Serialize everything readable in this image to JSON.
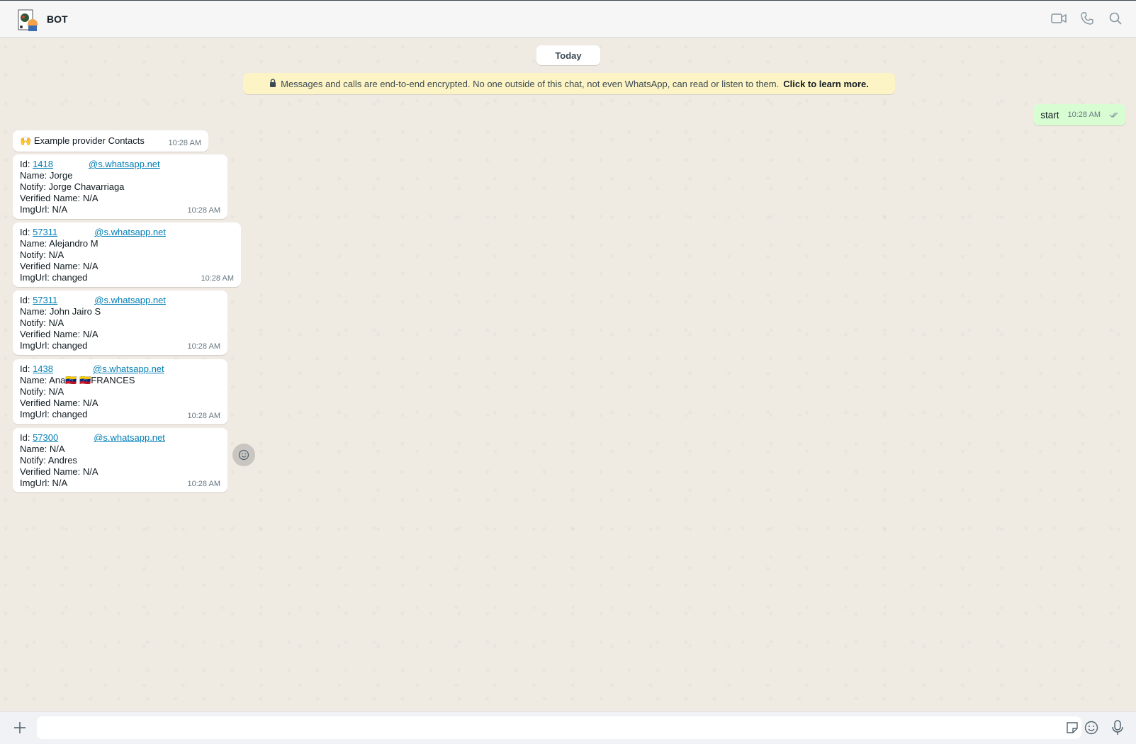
{
  "header": {
    "title": "BOT",
    "icons": [
      "video-call-icon",
      "voice-call-icon",
      "search-icon"
    ]
  },
  "chat": {
    "date_chip": "Today",
    "encryption": {
      "text": "Messages and calls are end-to-end encrypted. No one outside of this chat, not even WhatsApp, can read or listen to them.",
      "link": "Click to learn more."
    },
    "outgoing": {
      "text": "start",
      "time": "10:28 AM"
    },
    "heading": {
      "emoji": "🙌",
      "text": "Example provider Contacts",
      "time": "10:28 AM"
    },
    "contacts": [
      {
        "id_prefix": "Id: ",
        "id_num": "1418",
        "id_domain": "@s.whatsapp.net",
        "name": "Name: Jorge",
        "notify": "Notify: Jorge Chavarriaga",
        "verified": "Verified Name: N/A",
        "img": "ImgUrl: N/A",
        "time": "10:28 AM"
      },
      {
        "id_prefix": "Id: ",
        "id_num": "57311",
        "id_domain": "@s.whatsapp.net",
        "name": "Name: Alejandro M",
        "notify": "Notify: N/A",
        "verified": "Verified Name: N/A",
        "img": "ImgUrl: changed",
        "time": "10:28 AM"
      },
      {
        "id_prefix": "Id: ",
        "id_num": "57311",
        "id_domain": "@s.whatsapp.net",
        "name": "Name: John Jairo S",
        "notify": "Notify: N/A",
        "verified": "Verified Name: N/A",
        "img": "ImgUrl: changed",
        "time": "10:28 AM"
      },
      {
        "id_prefix": "Id: ",
        "id_num": "1438",
        "id_domain": "@s.whatsapp.net",
        "name": "Name: Ana🇻🇪 🇻🇪FRANCES",
        "notify": "Notify: N/A",
        "verified": "Verified Name: N/A",
        "img": "ImgUrl: changed",
        "time": "10:28 AM"
      },
      {
        "id_prefix": "Id: ",
        "id_num": "57300",
        "id_domain": "@s.whatsapp.net",
        "name": "Name: N/A",
        "notify": "Notify: Andres",
        "verified": "Verified Name: N/A",
        "img": "ImgUrl: N/A",
        "time": "10:28 AM"
      }
    ]
  },
  "composer": {
    "placeholder": "",
    "icons": [
      "plus-icon",
      "sticker-icon",
      "emoji-icon",
      "microphone-icon"
    ]
  },
  "colors": {
    "outgoing_bubble": "#d9fdd3",
    "incoming_bubble": "#ffffff",
    "link": "#027eb5",
    "banner": "#fdf4c5",
    "chat_bg": "#efeae2"
  }
}
